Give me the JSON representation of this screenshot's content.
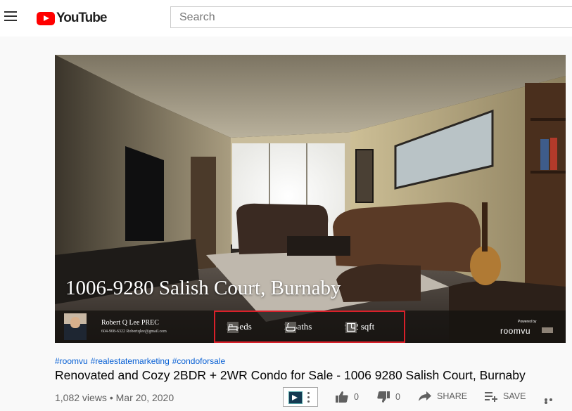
{
  "header": {
    "logo_text": "YouTube",
    "search_placeholder": "Search"
  },
  "video": {
    "overlay_title": "1006-9280 Salish Court, Burnaby",
    "agent_name": "Robert Q Lee PREC",
    "agent_contact": "604-908-6322   Robertqlee@gmail.com",
    "stats": {
      "beds": "2 Beds",
      "baths": "2 Baths",
      "area": "962 sqft"
    },
    "powered_by": "Powered by",
    "brand": "roomvu"
  },
  "info": {
    "hashtags": [
      "#roomvu",
      "#realestatemarketing",
      "#condoforsale"
    ],
    "title": "Renovated and Cozy 2BDR + 2WR Condo for Sale - 1006 9280 Salish Court, Burnaby",
    "views": "1,082 views",
    "separator": "•",
    "date": "Mar 20, 2020"
  },
  "actions": {
    "like_count": "0",
    "dislike_count": "0",
    "share_label": "SHARE",
    "save_label": "SAVE"
  },
  "colors": {
    "brand_red": "#ff0000",
    "link_blue": "#065fd4",
    "highlight_red": "#d9202a"
  }
}
